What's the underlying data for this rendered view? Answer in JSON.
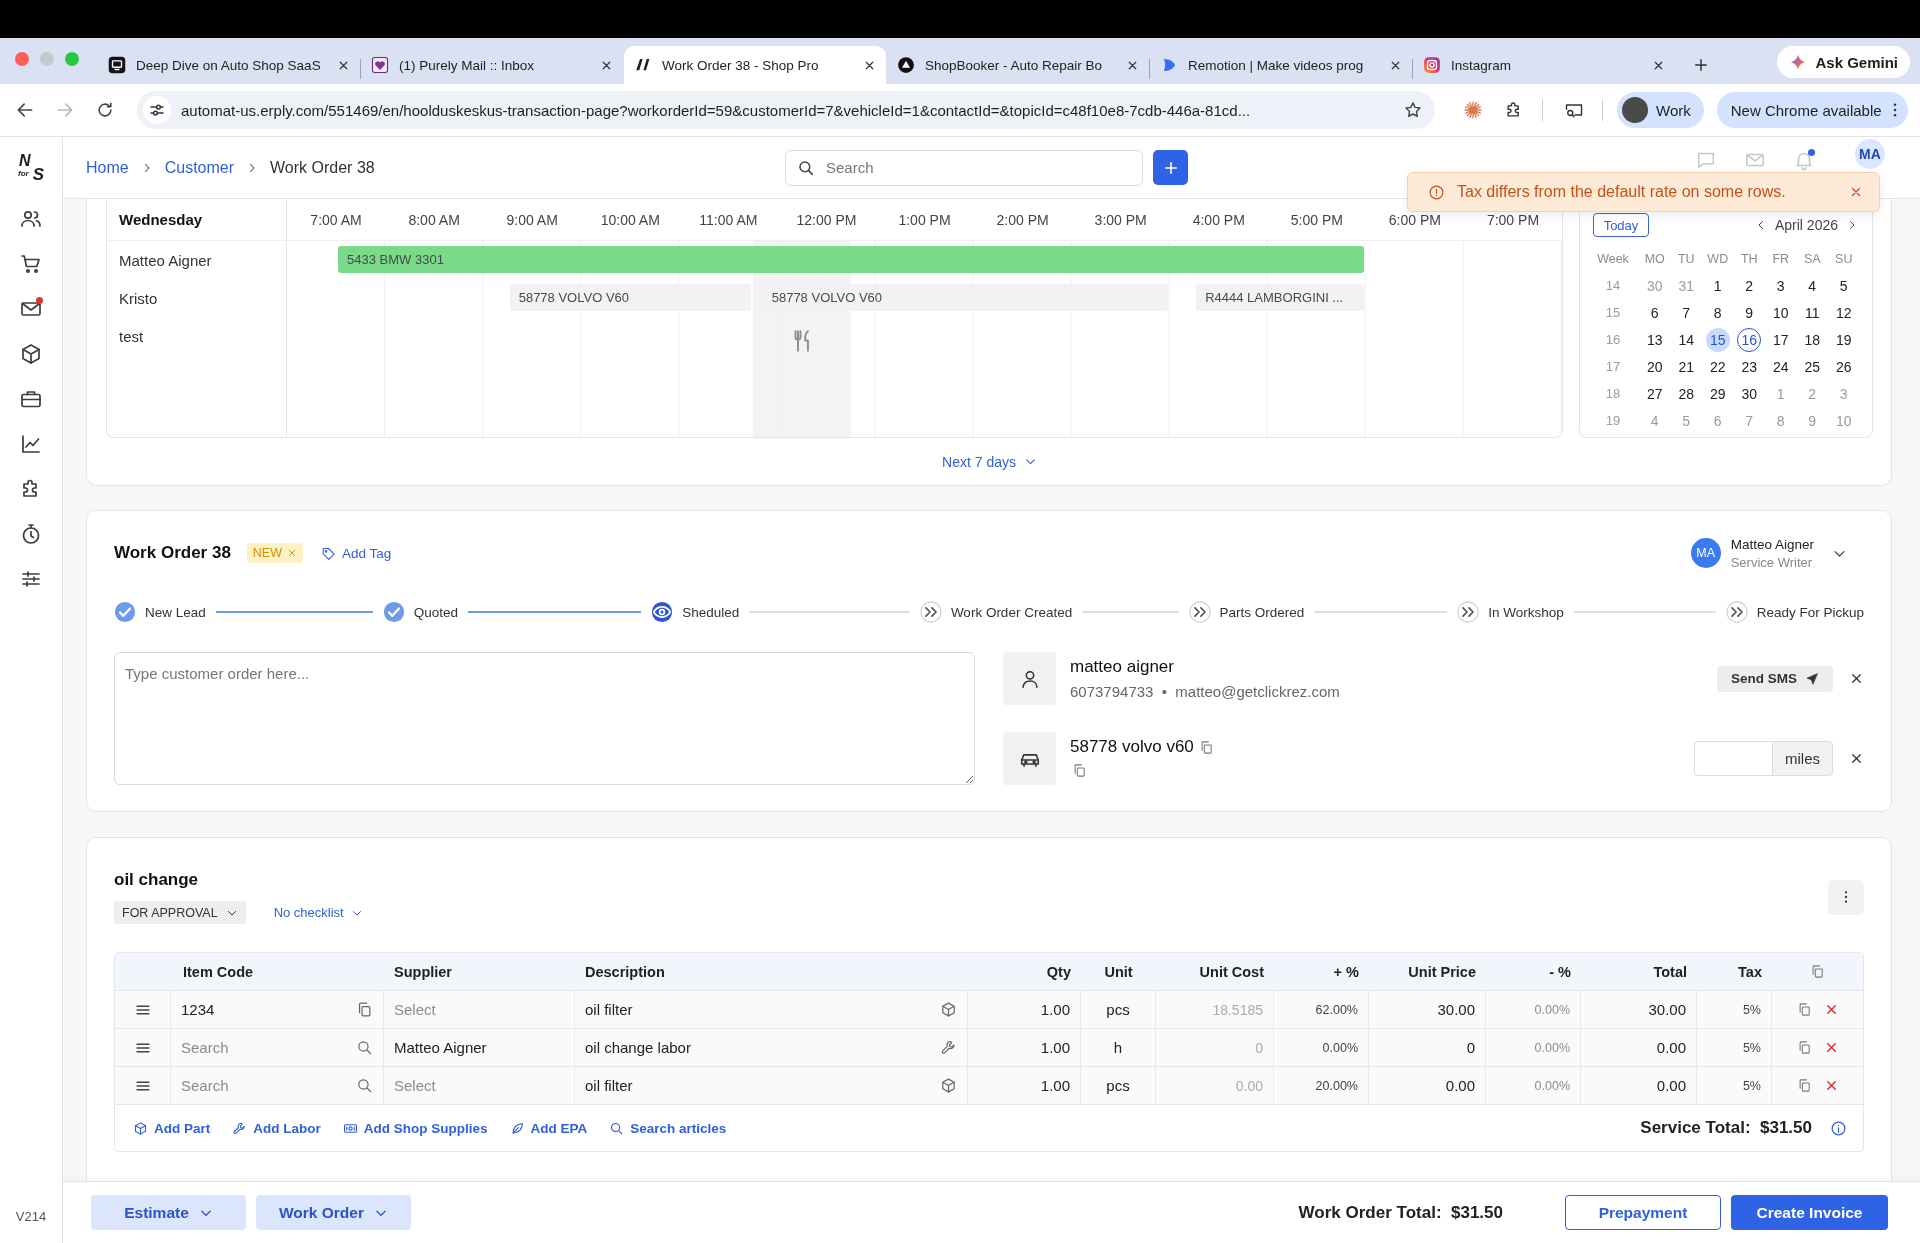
{
  "browser": {
    "tabs": [
      {
        "title": "Deep Dive on Auto Shop SaaS",
        "selected": false
      },
      {
        "title": "(1) Purely Mail :: Inbox",
        "selected": false
      },
      {
        "title": "Work Order 38 - Shop Pro",
        "selected": true
      },
      {
        "title": "ShopBooker - Auto Repair Bo",
        "selected": false
      },
      {
        "title": "Remotion | Make videos prog",
        "selected": false
      },
      {
        "title": "Instagram",
        "selected": false
      }
    ],
    "gemini": "Ask Gemini",
    "url": "automat-us.erply.com/551469/en/hoolduskeskus-transaction-page?workorderId=59&customerId=7&vehicleId=1&contactId=&topicId=c48f10e8-7cdb-446a-81cd...",
    "profile": "Work",
    "update": "New Chrome available"
  },
  "sidebar": {
    "logo": [
      "N",
      "for",
      "S"
    ],
    "items": [
      {
        "alert": false
      },
      {
        "alert": false
      },
      {
        "alert": true
      },
      {
        "alert": false
      },
      {
        "alert": false
      },
      {
        "alert": false
      },
      {
        "alert": false
      },
      {
        "alert": false
      },
      {
        "alert": false
      }
    ],
    "version": "V214"
  },
  "header": {
    "breadcrumbs": [
      {
        "label": "Home",
        "link": true
      },
      {
        "label": "Customer",
        "link": true
      },
      {
        "label": "Work Order 38",
        "link": false
      }
    ],
    "search": {
      "placeholder": "Search"
    },
    "icons": [
      {
        "alert": false
      },
      {
        "alert": false
      },
      {
        "alert": true
      }
    ],
    "avatar": "MA"
  },
  "toast": {
    "message": "Tax differs from the default rate on some rows."
  },
  "schedule": {
    "day": "Wednesday",
    "hours": [
      "7:00 AM",
      "8:00 AM",
      "9:00 AM",
      "10:00 AM",
      "11:00 AM",
      "12:00 PM",
      "1:00 PM",
      "2:00 PM",
      "3:00 PM",
      "4:00 PM",
      "5:00 PM",
      "6:00 PM",
      "7:00 PM"
    ],
    "rows": [
      {
        "name": "Matteo Aigner",
        "events": [
          {
            "label": "5433 BMW 3301",
            "color": "#79db8a"
          }
        ]
      },
      {
        "name": "Kristo",
        "events": [
          {
            "label": "58778 VOLVO V60",
            "color": "#f2f2f3"
          },
          {
            "label": "58778 VOLVO V60",
            "color": "#f2f2f3"
          },
          {
            "label": "R4444 LAMBORGINI ...",
            "color": "#f2f2f3"
          }
        ]
      },
      {
        "name": "test"
      }
    ],
    "more": "Next 7 days"
  },
  "calendar": {
    "today_button": "Today",
    "month": "April 2026",
    "headers": [
      "Week",
      "MO",
      "TU",
      "WD",
      "TH",
      "FR",
      "SA",
      "SU"
    ],
    "weeks": [
      {
        "week": "14",
        "days": [
          {
            "label": "30",
            "outside": true,
            "selected": false,
            "today": false
          },
          {
            "label": "31",
            "outside": true,
            "selected": false,
            "today": false
          },
          {
            "label": "1",
            "outside": false,
            "selected": false,
            "today": false
          },
          {
            "label": "2",
            "outside": false,
            "selected": false,
            "today": false
          },
          {
            "label": "3",
            "outside": false,
            "selected": false,
            "today": false
          },
          {
            "label": "4",
            "outside": false,
            "selected": false,
            "today": false
          },
          {
            "label": "5",
            "outside": false,
            "selected": false,
            "today": false
          }
        ]
      },
      {
        "week": "15",
        "days": [
          {
            "label": "6",
            "outside": false,
            "selected": false,
            "today": false
          },
          {
            "label": "7",
            "outside": false,
            "selected": false,
            "today": false
          },
          {
            "label": "8",
            "outside": false,
            "selected": false,
            "today": false
          },
          {
            "label": "9",
            "outside": false,
            "selected": false,
            "today": false
          },
          {
            "label": "10",
            "outside": false,
            "selected": false,
            "today": false
          },
          {
            "label": "11",
            "outside": false,
            "selected": false,
            "today": false
          },
          {
            "label": "12",
            "outside": false,
            "selected": false,
            "today": false
          }
        ]
      },
      {
        "week": "16",
        "days": [
          {
            "label": "13",
            "outside": false,
            "selected": false,
            "today": false
          },
          {
            "label": "14",
            "outside": false,
            "selected": false,
            "today": false
          },
          {
            "label": "15",
            "outside": false,
            "selected": true,
            "today": false
          },
          {
            "label": "16",
            "outside": false,
            "selected": false,
            "today": true
          },
          {
            "label": "17",
            "outside": false,
            "selected": false,
            "today": false
          },
          {
            "label": "18",
            "outside": false,
            "selected": false,
            "today": false
          },
          {
            "label": "19",
            "outside": false,
            "selected": false,
            "today": false
          }
        ]
      },
      {
        "week": "17",
        "days": [
          {
            "label": "20",
            "outside": false,
            "selected": false,
            "today": false
          },
          {
            "label": "21",
            "outside": false,
            "selected": false,
            "today": false
          },
          {
            "label": "22",
            "outside": false,
            "selected": false,
            "today": false
          },
          {
            "label": "23",
            "outside": false,
            "selected": false,
            "today": false
          },
          {
            "label": "24",
            "outside": false,
            "selected": false,
            "today": false
          },
          {
            "label": "25",
            "outside": false,
            "selected": false,
            "today": false
          },
          {
            "label": "26",
            "outside": false,
            "selected": false,
            "today": false
          }
        ]
      },
      {
        "week": "18",
        "days": [
          {
            "label": "27",
            "outside": false,
            "selected": false,
            "today": false
          },
          {
            "label": "28",
            "outside": false,
            "selected": false,
            "today": false
          },
          {
            "label": "29",
            "outside": false,
            "selected": false,
            "today": false
          },
          {
            "label": "30",
            "outside": false,
            "selected": false,
            "today": false
          },
          {
            "label": "1",
            "outside": true,
            "selected": false,
            "today": false
          },
          {
            "label": "2",
            "outside": true,
            "selected": false,
            "today": false
          },
          {
            "label": "3",
            "outside": true,
            "selected": false,
            "today": false
          }
        ]
      },
      {
        "week": "19",
        "days": [
          {
            "label": "4",
            "outside": true,
            "selected": false,
            "today": false
          },
          {
            "label": "5",
            "outside": true,
            "selected": false,
            "today": false
          },
          {
            "label": "6",
            "outside": true,
            "selected": false,
            "today": false
          },
          {
            "label": "7",
            "outside": true,
            "selected": false,
            "today": false
          },
          {
            "label": "8",
            "outside": true,
            "selected": false,
            "today": false
          },
          {
            "label": "9",
            "outside": true,
            "selected": false,
            "today": false
          },
          {
            "label": "10",
            "outside": true,
            "selected": false,
            "today": false
          }
        ]
      }
    ]
  },
  "work_order": {
    "title": "Work Order 38",
    "tag": "NEW",
    "add_tag": "Add Tag",
    "assignee": {
      "initials": "MA",
      "name": "Matteo Aigner",
      "role": "Service Writer"
    },
    "steps": [
      {
        "label": "New Lead",
        "done": true,
        "current": false
      },
      {
        "label": "Quoted",
        "done": true,
        "current": false
      },
      {
        "label": "Sheduled",
        "done": false,
        "current": true
      },
      {
        "label": "Work Order Created",
        "done": false,
        "current": false
      },
      {
        "label": "Parts Ordered",
        "done": false,
        "current": false
      },
      {
        "label": "In Workshop",
        "done": false,
        "current": false
      },
      {
        "label": "Ready For Pickup",
        "done": false,
        "current": false
      }
    ],
    "order_note": {
      "placeholder": "Type customer order here..."
    },
    "contact": {
      "name": "matteo aigner",
      "details": "6073794733  •  matteo@getclickrez.com",
      "send_sms": "Send SMS"
    },
    "vehicle": {
      "name": "58778 volvo v60",
      "mileage_unit": "miles"
    }
  },
  "job": {
    "title": "oil change",
    "status": "FOR APPROVAL",
    "checklist": "No checklist",
    "table": {
      "columns": [
        "Item Code",
        "Supplier",
        "Description",
        "Qty",
        "Unit",
        "Unit Cost",
        "+ %",
        "Unit Price",
        "- %",
        "Total",
        "Tax"
      ],
      "rows": [
        {
          "kind": "part",
          "item_code": {
            "value": "1234"
          },
          "supplier": {
            "placeholder": "Select"
          },
          "description": "oil filter",
          "qty": "1.00",
          "unit": "pcs",
          "unit_cost": "18.5185",
          "markup": "62.00%",
          "unit_price": "30.00",
          "discount": "0.00%",
          "total": "30.00",
          "tax": "5%"
        },
        {
          "kind": "labor",
          "item_code": {
            "placeholder": "Search"
          },
          "supplier": {
            "value": "Matteo Aigner"
          },
          "description": "oil change labor",
          "qty": "1.00",
          "unit": "h",
          "unit_cost": "0",
          "markup": "0.00%",
          "unit_price": "0",
          "discount": "0.00%",
          "total": "0.00",
          "tax": "5%"
        },
        {
          "kind": "part",
          "item_code": {
            "placeholder": "Search"
          },
          "supplier": {
            "placeholder": "Select"
          },
          "description": "oil filter",
          "qty": "1.00",
          "unit": "pcs",
          "unit_cost": "0.00",
          "markup": "20.00%",
          "unit_price": "0.00",
          "discount": "0.00%",
          "total": "0.00",
          "tax": "5%"
        }
      ]
    },
    "actions": [
      "Add Part",
      "Add Labor",
      "Add Shop Supplies",
      "Add EPA",
      "Search articles"
    ],
    "service_total": "Service Total:  $31.50"
  },
  "footer": {
    "buttons": [
      "Estimate",
      "Work Order"
    ],
    "total": "Work Order Total:  $31.50",
    "prepayment": "Prepayment",
    "create_invoice": "Create Invoice"
  }
}
